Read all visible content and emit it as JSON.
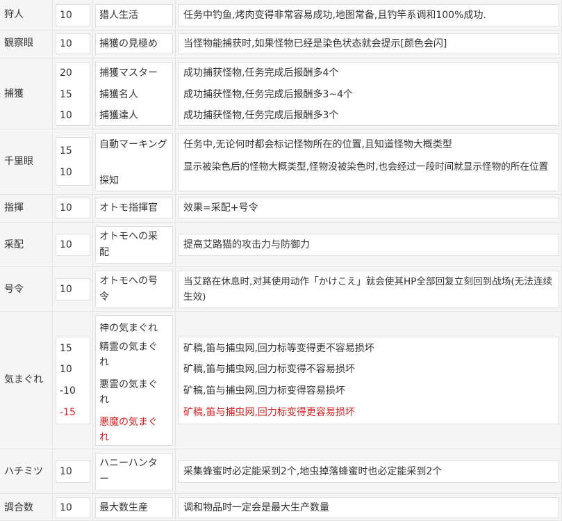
{
  "rows": [
    {
      "skill": "狩人",
      "points": [
        "10"
      ],
      "names": [
        "猎人生活"
      ],
      "effects": [
        "任务中钓鱼,烤肉变得非常容易成功,地图常备,且钓竿系调和100%成功."
      ]
    },
    {
      "skill": "観察眼",
      "points": [
        "10"
      ],
      "names": [
        "捕獲の見極め"
      ],
      "effects": [
        "当怪物能捕获时,如果怪物已经是染色状态就会提示[颜色会闪]"
      ]
    },
    {
      "skill": "捕獲",
      "points": [
        "20",
        "15",
        "10"
      ],
      "names": [
        "捕獲マスター",
        "捕獲名人",
        "捕獲達人"
      ],
      "effects": [
        "成功捕获怪物,任务完成后报酬多4个",
        "成功捕获怪物,任务完成后报酬多3~4个",
        "成功捕获怪物,任务完成后报酬多3个"
      ]
    },
    {
      "skill": "千里眼",
      "points": [
        "15",
        "10"
      ],
      "names": [
        "自動マーキング",
        "探知"
      ],
      "effects": [
        "任务中,无论何时都会标记怪物所在的位置,且知道怪物大概类型",
        "显示被染色后的怪物大概类型,怪物没被染色时,也会经过一段时间就显示怪物的所在位置"
      ]
    },
    {
      "skill": "指揮",
      "points": [
        "10"
      ],
      "names": [
        "オトモ指揮官"
      ],
      "effects": [
        "效果=采配+号令"
      ]
    },
    {
      "skill": "采配",
      "points": [
        "10"
      ],
      "names": [
        "オトモへの采配"
      ],
      "effects": [
        "提高艾路猫的攻击力与防御力"
      ]
    },
    {
      "skill": "号令",
      "points": [
        "10"
      ],
      "names": [
        "オトモへの号令"
      ],
      "effects": [
        "当艾路在休息时,对其使用动作「かけこえ」就会使其HP全部回复立刻回到战场(无法连续生效)"
      ]
    },
    {
      "skill": "気まぐれ",
      "points": [
        "15",
        "10",
        "-10",
        "-15"
      ],
      "names": [
        "神の気まぐれ",
        "精霊の気まぐれ",
        "悪霊の気まぐれ",
        "悪魔の気まぐれ"
      ],
      "effects": [
        "矿稿,笛与捕虫网,回力标等变得更不容易损坏",
        "矿稿,笛与捕虫网,回力标变得不容易损坏",
        "矿稿,笛与捕虫网,回力标变得容易损坏",
        "矿稿,笛与捕虫网,回力标变得更容易损坏"
      ]
    },
    {
      "skill": "ハチミツ",
      "points": [
        "10"
      ],
      "names": [
        "ハニーハンター"
      ],
      "effects": [
        "采集蜂蜜时必定能采到2个,地虫掉落蜂蜜时也必定能采到2个"
      ]
    },
    {
      "skill": "調合数",
      "points": [
        "10"
      ],
      "names": [
        "最大数生産"
      ],
      "effects": [
        "调和物品时一定会是最大生产数量"
      ]
    }
  ],
  "colors": {
    "negative": "#d81e1e",
    "text": "#333333",
    "cell_bg": "#f5f5f5",
    "box_border": "#dddddd"
  }
}
